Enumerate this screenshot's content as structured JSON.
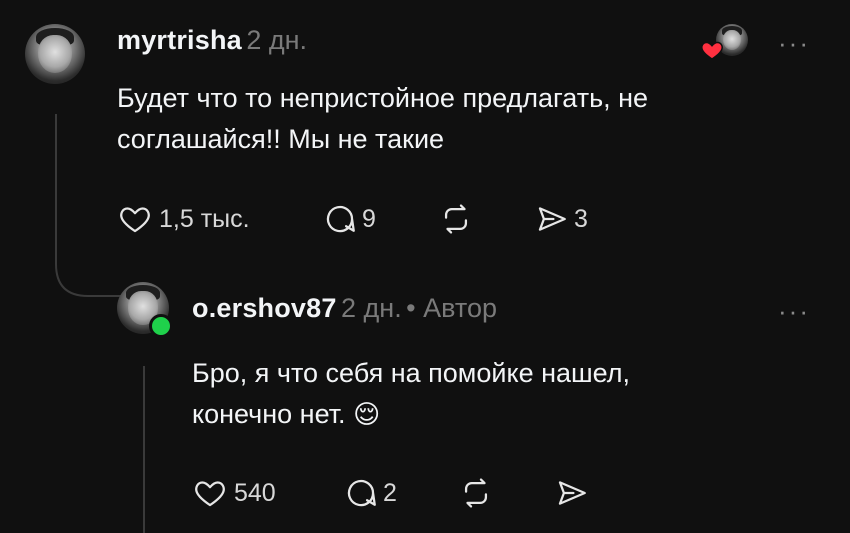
{
  "comment": {
    "username": "myrtrisha",
    "time": "2 дн.",
    "text_line1": "Будет что то непристойное предлагать, не",
    "text_line2": "соглашайся!! Мы не такие",
    "likes": "1,5 тыс.",
    "replies": "9",
    "shares": "3",
    "more_label": "···"
  },
  "reply": {
    "username": "o.ershov87",
    "time": "2 дн.",
    "author_label": "• Автор",
    "text_line1": "Бро, я что себя на помойке нашел,",
    "text_line2": "конечно нет.",
    "emoji": "😌",
    "likes": "540",
    "replies": "2",
    "more_label": "···"
  },
  "colors": {
    "background": "#101010",
    "text": "#f3f5f7",
    "muted": "#7a7a7a",
    "online": "#1fd14b",
    "like_heart": "#ff3040"
  }
}
